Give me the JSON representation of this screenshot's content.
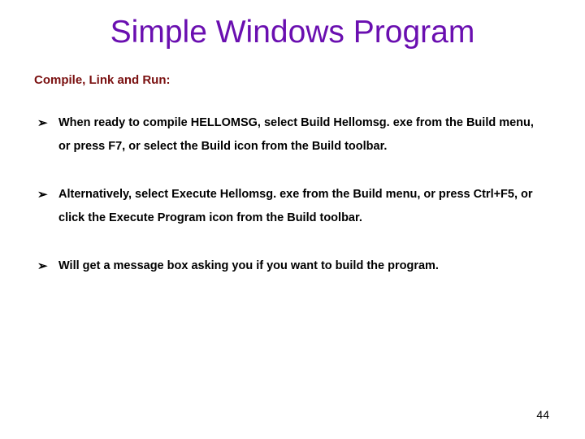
{
  "title": "Simple Windows Program",
  "subheading": "Compile, Link and Run:",
  "bullets": [
    "When ready to compile HELLOMSG, select Build Hellomsg. exe from the Build menu, or press F7, or select the Build icon from the Build toolbar.",
    "Alternatively, select Execute Hellomsg. exe from the Build menu, or press Ctrl+F5, or click the Execute Program icon from the Build toolbar.",
    "Will get a message box asking you if you want to build the program."
  ],
  "page_number": "44"
}
